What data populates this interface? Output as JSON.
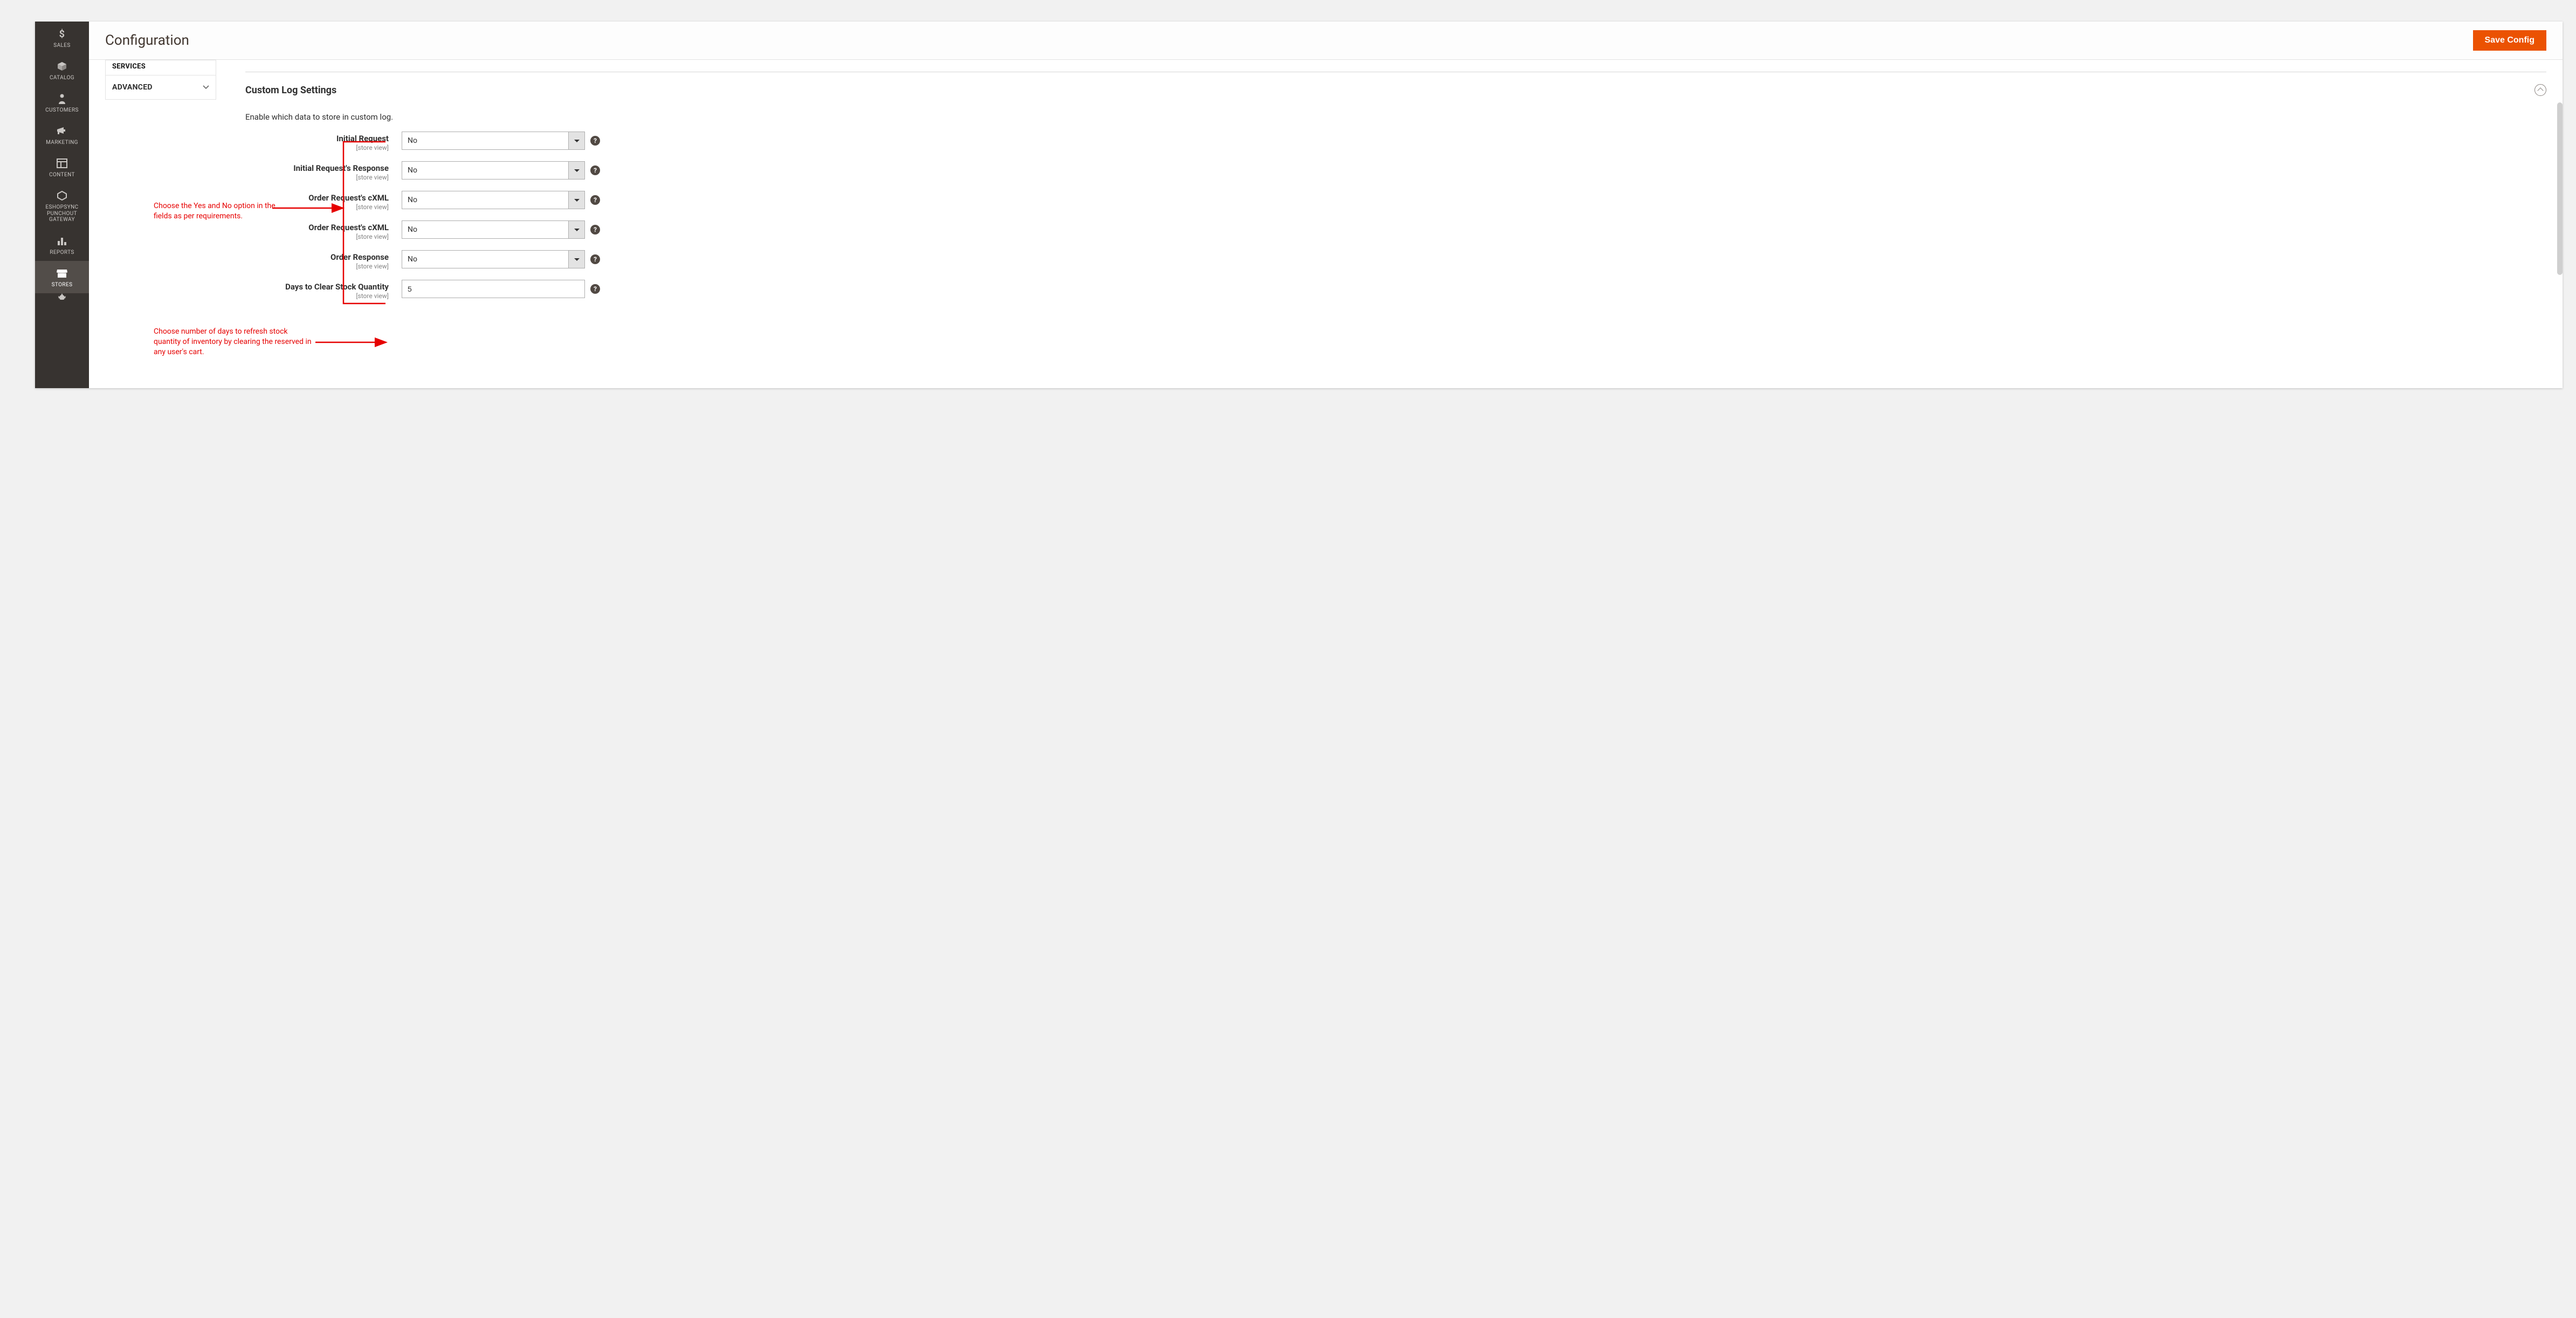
{
  "header": {
    "title": "Configuration",
    "save_label": "Save Config"
  },
  "sidebar": {
    "items": [
      {
        "key": "sales",
        "label": "SALES"
      },
      {
        "key": "catalog",
        "label": "CATALOG"
      },
      {
        "key": "customers",
        "label": "CUSTOMERS"
      },
      {
        "key": "marketing",
        "label": "MARKETING"
      },
      {
        "key": "content",
        "label": "CONTENT"
      },
      {
        "key": "punchout",
        "label": "ESHOPSYNC PUNCHOUT GATEWAY"
      },
      {
        "key": "reports",
        "label": "REPORTS"
      },
      {
        "key": "stores",
        "label": "STORES"
      }
    ]
  },
  "categories": {
    "truncated_top": "SERVICES",
    "advanced_label": "ADVANCED"
  },
  "section": {
    "title": "Custom Log Settings",
    "description": "Enable which data to store in custom log.",
    "fields": [
      {
        "label": "Initial Request",
        "scope": "[store view]",
        "value": "No"
      },
      {
        "label": "Initial Request's Response",
        "scope": "[store view]",
        "value": "No"
      },
      {
        "label": "Order Request's cXML",
        "scope": "[store view]",
        "value": "No"
      },
      {
        "label": "Order Request's cXML",
        "scope": "[store view]",
        "value": "No"
      },
      {
        "label": "Order Response",
        "scope": "[store view]",
        "value": "No"
      }
    ],
    "days_field": {
      "label": "Days to Clear Stock Quantity",
      "scope": "[store view]",
      "value": "5"
    }
  },
  "annotations": {
    "yesno": "Choose the Yes and No option in the fields as per requirements.",
    "days": "Choose number of days to refresh stock quantity of inventory by clearing the reserved in any user's cart."
  },
  "icons": {
    "help": "?"
  }
}
